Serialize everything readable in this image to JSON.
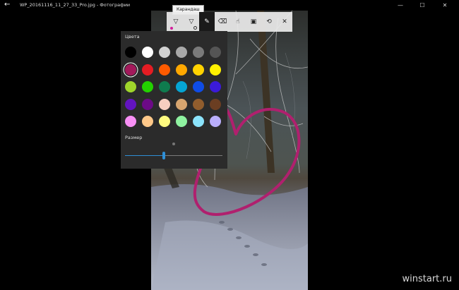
{
  "window": {
    "back_icon": "arrow-left-icon",
    "title": "WP_20161116_11_27_33_Pro.jpg - Фотографии",
    "minimize": "—",
    "maximize": "☐",
    "close": "✕"
  },
  "toolbar": {
    "tooltip": "Карандаш",
    "tools": [
      {
        "name": "ballpoint-pen",
        "icon": "pen-icon",
        "color": "#d21f9b"
      },
      {
        "name": "pencil",
        "icon": "pencil-icon"
      },
      {
        "name": "calligraphy-pen",
        "icon": "calligraphy-pen-icon",
        "active": true
      },
      {
        "name": "eraser",
        "icon": "eraser-icon"
      },
      {
        "name": "touch-writing",
        "icon": "touch-writing-icon"
      },
      {
        "name": "save",
        "icon": "save-icon"
      },
      {
        "name": "share",
        "icon": "share-icon"
      },
      {
        "name": "close",
        "icon": "close-icon"
      }
    ]
  },
  "colors_panel": {
    "title": "Цвета",
    "selected": "#a3195b",
    "swatches": [
      "#000000",
      "#ffffff",
      "#d1d1d1",
      "#a8a8a8",
      "#7a7a7a",
      "#555555",
      "#a3195b",
      "#e51c23",
      "#fe5b00",
      "#ffa800",
      "#ffd200",
      "#fff100",
      "#9fd52b",
      "#23d100",
      "#0f7b4e",
      "#05a4d3",
      "#0f4ce6",
      "#3b1ad8",
      "#6214c0",
      "#6c0a86",
      "#f6cec0",
      "#d7a56f",
      "#915d2d",
      "#6b3e22",
      "#f88ff5",
      "#ffc889",
      "#fffb80",
      "#8ff2a0",
      "#8be3fb",
      "#b9aefb"
    ],
    "size_label": "Размер",
    "size_value": 0.4
  },
  "watermark": "winstart.ru"
}
